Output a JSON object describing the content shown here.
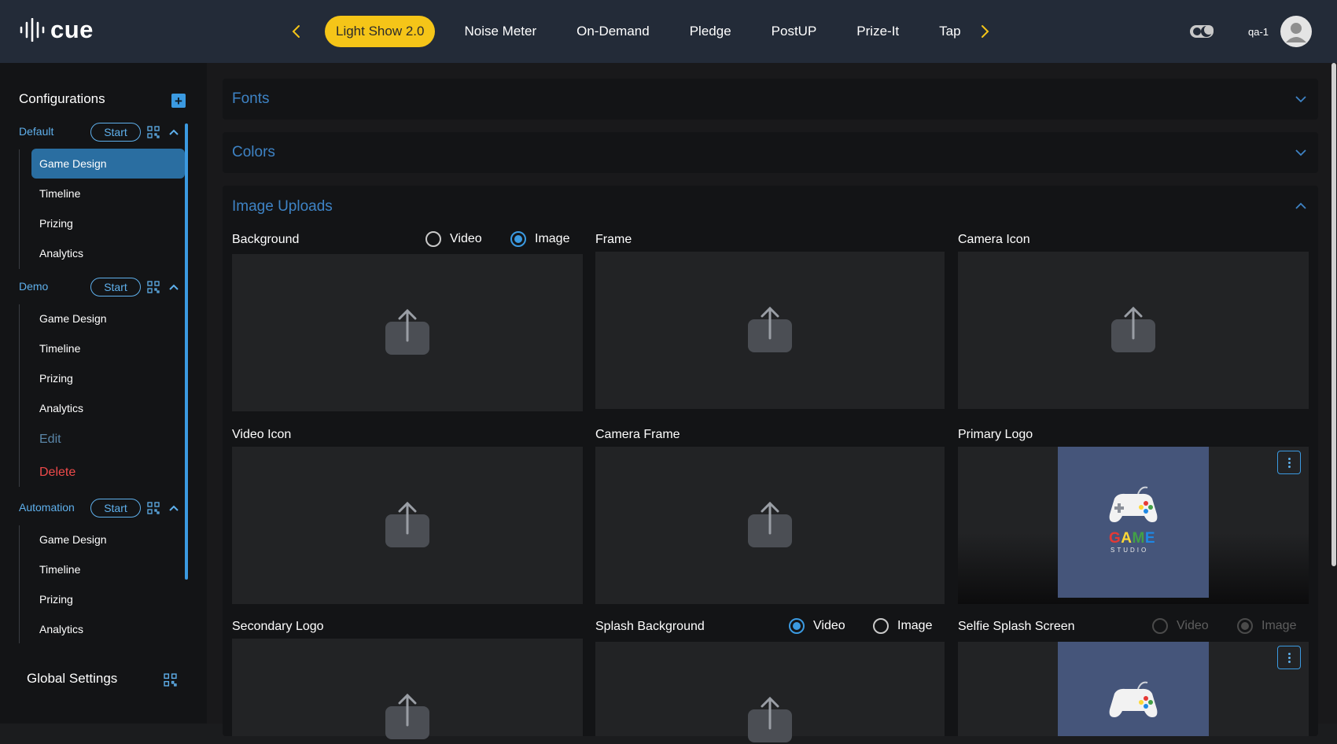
{
  "header": {
    "logo_text": "cue",
    "tabs": [
      "Light Show 2.0",
      "Noise Meter",
      "On-Demand",
      "Pledge",
      "PostUP",
      "Prize-It",
      "Tap"
    ],
    "active_tab": "Light Show 2.0",
    "user_name": "qa-1"
  },
  "sidebar": {
    "title": "Configurations",
    "start_label": "Start",
    "configs": [
      {
        "name": "Default",
        "items": [
          "Game Design",
          "Timeline",
          "Prizing",
          "Analytics"
        ]
      },
      {
        "name": "Demo",
        "items": [
          "Game Design",
          "Timeline",
          "Prizing",
          "Analytics",
          "Edit",
          "Delete"
        ]
      },
      {
        "name": "Automation",
        "items": [
          "Game Design",
          "Timeline",
          "Prizing",
          "Analytics"
        ]
      }
    ],
    "active_item": "Default / Game Design",
    "global_settings": "Global Settings"
  },
  "main": {
    "panels": {
      "fonts": "Fonts",
      "colors": "Colors",
      "image_uploads": "Image Uploads"
    },
    "uploads": {
      "background": "Background",
      "frame": "Frame",
      "camera_icon": "Camera Icon",
      "video_icon": "Video Icon",
      "camera_frame": "Camera Frame",
      "primary_logo": "Primary Logo",
      "secondary_logo": "Secondary Logo",
      "splash_background": "Splash Background",
      "selfie_splash_screen": "Selfie Splash Screen"
    },
    "radio": {
      "video": "Video",
      "image": "Image"
    },
    "logo_image_text": {
      "game": "GAME",
      "studio": "STUDIO"
    }
  },
  "colors": {
    "accent": "#3b9ae1",
    "active_tab": "#f5c518",
    "delete": "#ef4a4a",
    "topbar": "#232b38"
  }
}
